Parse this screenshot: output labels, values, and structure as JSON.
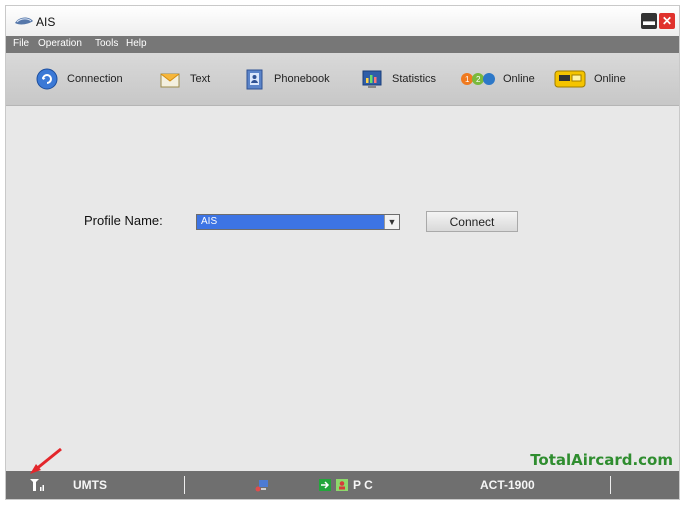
{
  "window": {
    "title": "AIS"
  },
  "menu": {
    "items": [
      {
        "label": "File"
      },
      {
        "label": "Operation"
      },
      {
        "label": "Tools"
      },
      {
        "label": "Help"
      }
    ]
  },
  "toolbar": {
    "items": [
      {
        "label": "Connection",
        "icon": "connection-icon"
      },
      {
        "label": "Text",
        "icon": "envelope-icon"
      },
      {
        "label": "Phonebook",
        "icon": "phonebook-icon"
      },
      {
        "label": "Statistics",
        "icon": "statistics-icon"
      },
      {
        "label": "Online",
        "icon": "1-2-call-icon"
      },
      {
        "label": "Online",
        "icon": "gsm-icon"
      }
    ]
  },
  "profile": {
    "label": "Profile Name:",
    "value": "AIS"
  },
  "actions": {
    "connect_label": "Connect"
  },
  "watermark": {
    "text": "TotalAircard.com"
  },
  "status": {
    "network": "UMTS",
    "mode": "P C",
    "operator": "ACT-1900"
  },
  "colors": {
    "menu_bg": "#777777",
    "status_bg": "#6f6f6f",
    "selection": "#3d74e4",
    "watermark": "#2f8d2f",
    "close_button": "#e0322d"
  }
}
